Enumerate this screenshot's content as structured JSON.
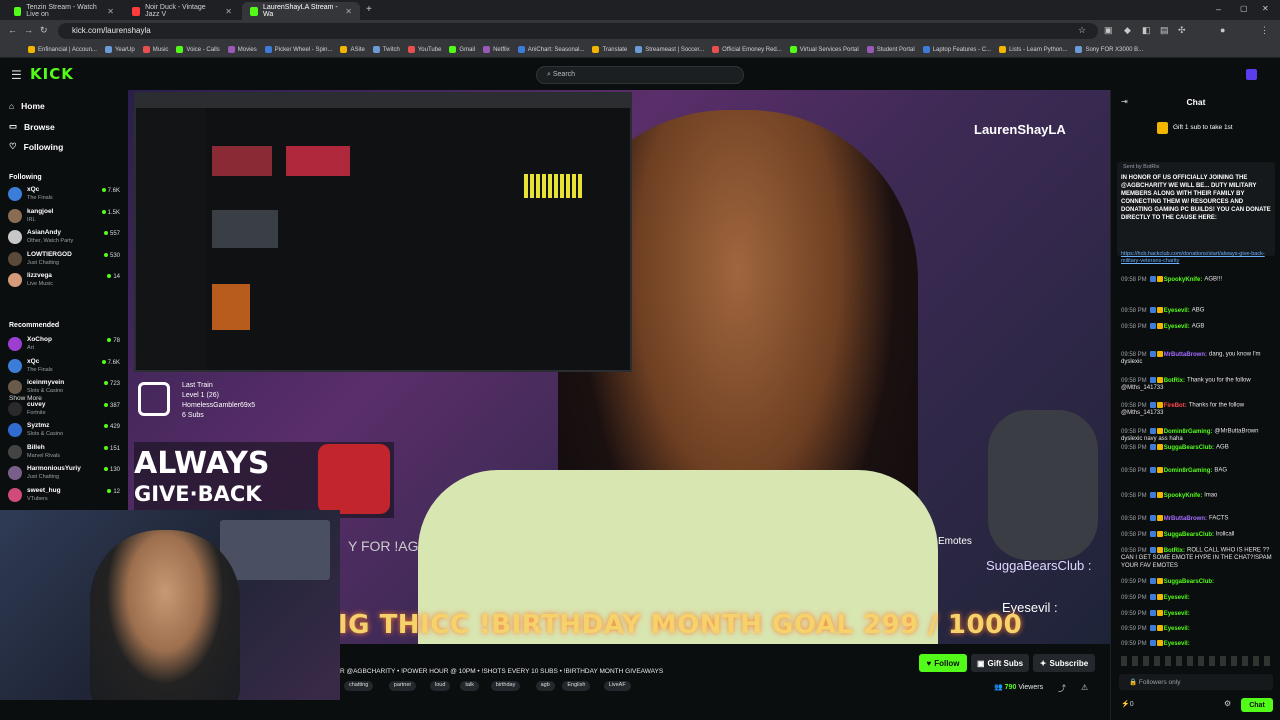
{
  "browser": {
    "tabs": [
      {
        "label": "Tenzin Stream - Watch Live on",
        "color": "#53fc18",
        "active": false
      },
      {
        "label": "Noir Duck - Vintage Jazz V",
        "color": "#ff3b3b",
        "active": false
      },
      {
        "label": "LaurenShayLA Stream - Wa",
        "color": "#53fc18",
        "active": true
      }
    ],
    "url": "kick.com/laurenshayla",
    "bookmarks": [
      "Enfinancial | Accoun...",
      "YearUp",
      "Music",
      "Voice - Calls",
      "Movies",
      "Picker Wheel - Spin...",
      "ASite",
      "Twitch",
      "YouTube",
      "Gmail",
      "Netflix",
      "AniChart: Seasonal...",
      "Translate",
      "Streameast | Soccer...",
      "Official Emoney Red...",
      "Virtual Services Portal",
      "Student Portal",
      "Laptop Features - C...",
      "Lists - Learn Python...",
      "Sony FOR X3000 B..."
    ]
  },
  "header": {
    "logo": "KICK",
    "search_placeholder": "Search"
  },
  "sidebar": {
    "nav": [
      {
        "label": "Home",
        "icon": "home-icon"
      },
      {
        "label": "Browse",
        "icon": "browse-icon"
      },
      {
        "label": "Following",
        "icon": "heart-icon"
      }
    ],
    "following_title": "Following",
    "following": [
      {
        "name": "xQc",
        "category": "The Finals",
        "viewers": "7.6K",
        "color": "#3b7dd8"
      },
      {
        "name": "kangjoel",
        "category": "IRL",
        "viewers": "1.5K",
        "color": "#8a6c52"
      },
      {
        "name": "AsianAndy",
        "category": "Other, Watch Party",
        "viewers": "557",
        "color": "#c7c7c7"
      },
      {
        "name": "LOWTIERGOD",
        "category": "Just Chatting",
        "viewers": "530",
        "color": "#5b4a3a"
      },
      {
        "name": "lizzvega",
        "category": "Live Music",
        "viewers": "14",
        "color": "#d49a7a"
      }
    ],
    "show_more": "Show More",
    "recommended_title": "Recommended",
    "recommended": [
      {
        "name": "XoChop",
        "category": "Art",
        "viewers": "78",
        "color": "#9c3fd1"
      },
      {
        "name": "xQc",
        "category": "The Finals",
        "viewers": "7.6K",
        "color": "#3b7dd8"
      },
      {
        "name": "iceinmyvein",
        "category": "Slots & Casino",
        "viewers": "723",
        "color": "#6a5a4a"
      },
      {
        "name": "cuvey",
        "category": "Fortnite",
        "viewers": "387",
        "color": "#2a2a2a"
      },
      {
        "name": "Syztmz",
        "category": "Slots & Casino",
        "viewers": "429",
        "color": "#2f6bd1"
      },
      {
        "name": "Billeh",
        "category": "Marvel Rivals",
        "viewers": "151",
        "color": "#444"
      },
      {
        "name": "HarmoniousYuriy",
        "category": "Just Chatting",
        "viewers": "130",
        "color": "#7a5f8a"
      },
      {
        "name": "sweet_hug",
        "category": "VTubers",
        "viewers": "12",
        "color": "#d14b7a"
      }
    ]
  },
  "video": {
    "channel_overlay": "LaurenShayLA",
    "last_train": {
      "title": "Last Train",
      "level": "Level 1 (26)",
      "user": "HomelessGambler69x5",
      "subs": "6 Subs"
    },
    "agb_line1": "ALWAYS",
    "agb_line2": "GIVE·BACK",
    "for_ag": "Y FOR !AG",
    "goal": "IG THICC !BIRTHDAY MONTH GOAL  299 / 1000",
    "emotes_label": "Emotes",
    "chat_overlay_1": "SuggaBearsClub :",
    "chat_overlay_2": "Eyesevil :"
  },
  "stream": {
    "title": "R @AGBCHARITY • !POWER HOUR @ 10PM • !SHOTS EVERY 10 SUBS • !BIRTHDAY MONTH GIVEAWAYS",
    "tags": [
      "chatting",
      "partner",
      "loud",
      "talk",
      "birthday",
      "agb",
      "English",
      "LiveAF"
    ],
    "follow": "Follow",
    "gift": "Gift Subs",
    "subscribe": "Subscribe",
    "viewers": "790",
    "viewers_label": "Viewers"
  },
  "chat": {
    "title": "Chat",
    "gift_banner": "Gift 1 sub to take 1st",
    "pinned_by": "Sent by BotRix",
    "pinned_text": "IN HONOR OF US OFFICIALLY JOINING THE @AGBCHARITY WE WILL BE... DUTY MILITARY MEMBERS ALONG WITH THEIR FAMILY BY CONNECTING THEM W/ RESOURCES AND DONATING GAMING PC BUILDS! YOU CAN DONATE DIRECTLY TO THE CAUSE HERE:",
    "pinned_link": "https://hcb.hackclub.com/donations/start/always-give-back-military-veterans-charity",
    "messages": [
      {
        "time": "09:58 PM",
        "user": "SpookyKnife:",
        "color": "#53fc18",
        "text": "AGB!!!"
      },
      {
        "time": "09:58 PM",
        "user": "Eyesevil:",
        "color": "#53fc18",
        "text": "ABG"
      },
      {
        "time": "09:58 PM",
        "user": "Eyesevil:",
        "color": "#53fc18",
        "text": "AGB"
      },
      {
        "time": "09:58 PM",
        "user": "MrButtaBrown:",
        "color": "#a46bff",
        "text": "dang, you know I'm dyslexic"
      },
      {
        "time": "09:58 PM",
        "user": "BotRix:",
        "color": "#53fc18",
        "text": "Thank you for the follow @Mths_141733"
      },
      {
        "time": "09:58 PM",
        "user": "FireBot:",
        "color": "#ff4a4a",
        "text": "Thanks for the follow @Mths_141733"
      },
      {
        "time": "09:58 PM",
        "user": "Domin8rGaming:",
        "color": "#53fc18",
        "text": "@MrButtaBrown dyslexic navy ass haha"
      },
      {
        "time": "09:58 PM",
        "user": "SuggaBearsClub:",
        "color": "#53fc18",
        "text": "AGB"
      },
      {
        "time": "09:58 PM",
        "user": "Domin8rGaming:",
        "color": "#53fc18",
        "text": "BAG"
      },
      {
        "time": "09:58 PM",
        "user": "SpookyKnife:",
        "color": "#53fc18",
        "text": "lmao"
      },
      {
        "time": "09:58 PM",
        "user": "MrButtaBrown:",
        "color": "#a46bff",
        "text": "FACTS"
      },
      {
        "time": "09:58 PM",
        "user": "SuggaBearsClub:",
        "color": "#53fc18",
        "text": "lrollcall"
      },
      {
        "time": "09:58 PM",
        "user": "BotRix:",
        "color": "#53fc18",
        "text": "ROLL CALL WHO IS HERE ?? CAN I GET SOME EMOTE HYPE IN THE CHAT?!SPAM YOUR FAV EMOTES"
      },
      {
        "time": "09:59 PM",
        "user": "SuggaBearsClub:",
        "color": "#53fc18",
        "text": ""
      },
      {
        "time": "09:59 PM",
        "user": "Eyesevil:",
        "color": "#53fc18",
        "text": ""
      },
      {
        "time": "09:59 PM",
        "user": "Eyesevil:",
        "color": "#53fc18",
        "text": ""
      },
      {
        "time": "09:59 PM",
        "user": "Eyesevil:",
        "color": "#53fc18",
        "text": ""
      },
      {
        "time": "09:59 PM",
        "user": "Eyesevil:",
        "color": "#53fc18",
        "text": ""
      }
    ],
    "followers_only": "Followers only",
    "points": "0",
    "send": "Chat"
  }
}
